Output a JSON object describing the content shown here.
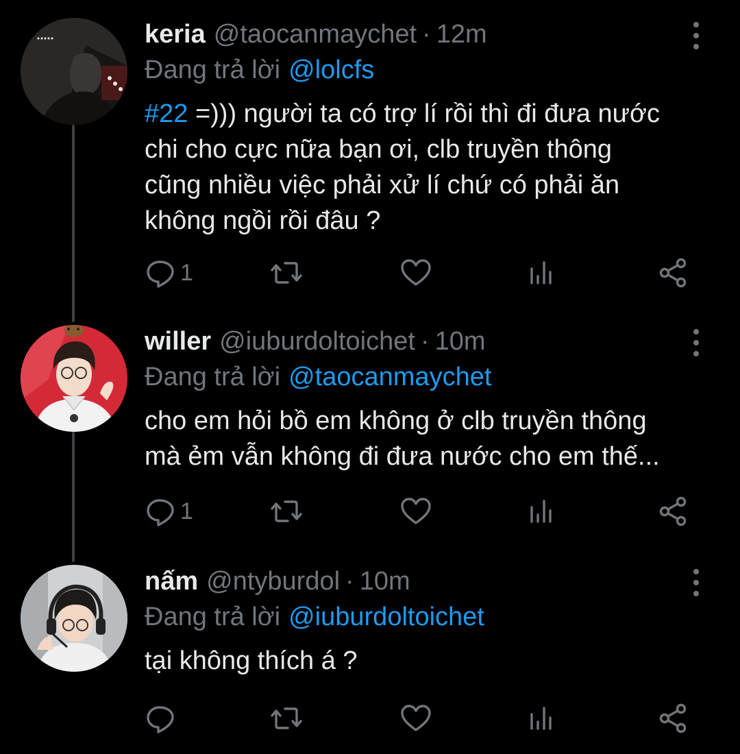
{
  "tweets": [
    {
      "name": "keria",
      "handle": "@taocanmaychet",
      "separator": "·",
      "time": "12m",
      "reply_prefix": "Đang trả lời",
      "reply_to": "@lolcfs",
      "hashtag": "#22",
      "text_lines": [
        " =))) người ta có trợ lí rồi thì đi đưa nước",
        "chi cho cực nữa bạn ơi, clb truyền thông",
        "cũng nhiều việc phải xử lí chứ có phải ăn",
        "không ngồi rồi đâu ?"
      ],
      "reply_count": "1",
      "avatar_icon": "dark-profile-photo"
    },
    {
      "name": "willer",
      "handle": "@iuburdoltoichet",
      "separator": "·",
      "time": "10m",
      "reply_prefix": "Đang trả lời",
      "reply_to": "@taocanmaychet",
      "text_lines": [
        "cho em hỏi bồ em không ở clb truyền thông",
        "mà ẻm vẫn không đi đưa nước cho em thế..."
      ],
      "reply_count": "1",
      "avatar_icon": "red-profile-photo"
    },
    {
      "name": "nấm",
      "handle": "@ntyburdol",
      "separator": "·",
      "time": "10m",
      "reply_prefix": "Đang trả lời",
      "reply_to": "@iuburdoltoichet",
      "text_lines": [
        "tại không thích á ?"
      ],
      "reply_count": "",
      "avatar_icon": "headset-profile-photo"
    }
  ],
  "colors": {
    "background": "#000000",
    "text": "#e7e9ea",
    "secondary": "#71767b",
    "accent": "#1d9bf0",
    "thread_line": "#3e4144"
  }
}
